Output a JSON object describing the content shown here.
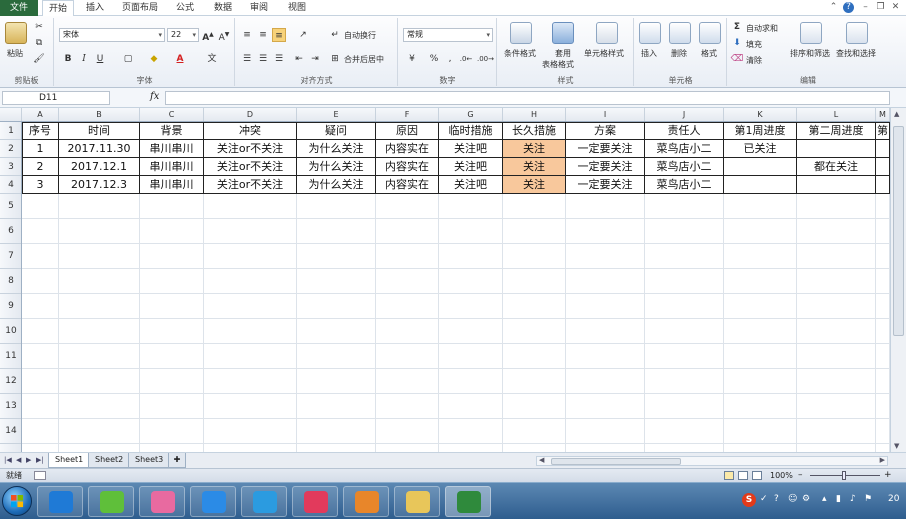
{
  "ribbon_tabs": [
    "文件",
    "开始",
    "插入",
    "页面布局",
    "公式",
    "数据",
    "审阅",
    "视图"
  ],
  "clipboard": {
    "paste": "粘贴",
    "group": "剪贴板"
  },
  "font": {
    "name": "宋体",
    "size": "22",
    "group": "字体",
    "bold": "B",
    "italic": "I",
    "underline": "U"
  },
  "alignment": {
    "wrap": "自动换行",
    "merge": "合并后居中",
    "group": "对齐方式"
  },
  "number": {
    "format": "常规",
    "percent": "%",
    "comma": ",",
    "group": "数字"
  },
  "styles": {
    "cond": "条件格式",
    "table_line1": "套用",
    "table_line2": "表格格式",
    "cell": "单元格样式",
    "group": "样式"
  },
  "cells_group": {
    "insert": "插入",
    "delete": "删除",
    "format": "格式",
    "group": "单元格"
  },
  "editing": {
    "autosum": "自动求和",
    "fill": "填充",
    "clear": "清除",
    "sort": "排序和筛选",
    "find": "查找和选择",
    "group": "编辑"
  },
  "formula_bar": {
    "name_box": "D11",
    "fx": "fx",
    "value": ""
  },
  "columns": [
    "A",
    "B",
    "C",
    "D",
    "E",
    "F",
    "G",
    "H",
    "I",
    "J",
    "K",
    "L",
    "M"
  ],
  "rows": [
    "1",
    "2",
    "3",
    "4",
    "5",
    "6",
    "7",
    "8",
    "9",
    "10",
    "11",
    "12",
    "13",
    "14"
  ],
  "table": {
    "headers": [
      "序号",
      "时间",
      "背景",
      "冲突",
      "疑问",
      "原因",
      "临时措施",
      "长久措施",
      "方案",
      "责任人",
      "第1周进度",
      "第二周进度",
      "第"
    ],
    "rows": [
      [
        "1",
        "2017.11.30",
        "串川串川",
        "关注or不关注",
        "为什么关注",
        "内容实在",
        "关注吧",
        "关注",
        "一定要关注",
        "菜鸟店小二",
        "已关注",
        "",
        ""
      ],
      [
        "2",
        "2017.12.1",
        "串川串川",
        "关注or不关注",
        "为什么关注",
        "内容实在",
        "关注吧",
        "关注",
        "一定要关注",
        "菜鸟店小二",
        "",
        "都在关注",
        ""
      ],
      [
        "3",
        "2017.12.3",
        "串川串川",
        "关注or不关注",
        "为什么关注",
        "内容实在",
        "关注吧",
        "关注",
        "一定要关注",
        "菜鸟店小二",
        "",
        "",
        ""
      ]
    ],
    "highlight_column": 7,
    "highlight_color": "#f8c89c"
  },
  "sheets": [
    "Sheet1",
    "Sheet2",
    "Sheet3"
  ],
  "status": {
    "ready": "就绪",
    "zoom": "100%"
  },
  "taskbar": {
    "apps": [
      {
        "icon": "sogou-icon",
        "color": "#1f7ad6"
      },
      {
        "icon": "wechat-icon",
        "color": "#5fbf3a"
      },
      {
        "icon": "paint-icon",
        "color": "#e86aa0"
      },
      {
        "icon": "baidu-netdisk-icon",
        "color": "#2b8be6"
      },
      {
        "icon": "pptv-icon",
        "color": "#2b9be0"
      },
      {
        "icon": "camera-icon",
        "color": "#e23a5c"
      },
      {
        "icon": "outlook-icon",
        "color": "#e8862a"
      },
      {
        "icon": "folder-icon",
        "color": "#e8c65a"
      },
      {
        "icon": "excel-icon",
        "color": "#2f8a3c"
      }
    ],
    "clock": "20"
  }
}
